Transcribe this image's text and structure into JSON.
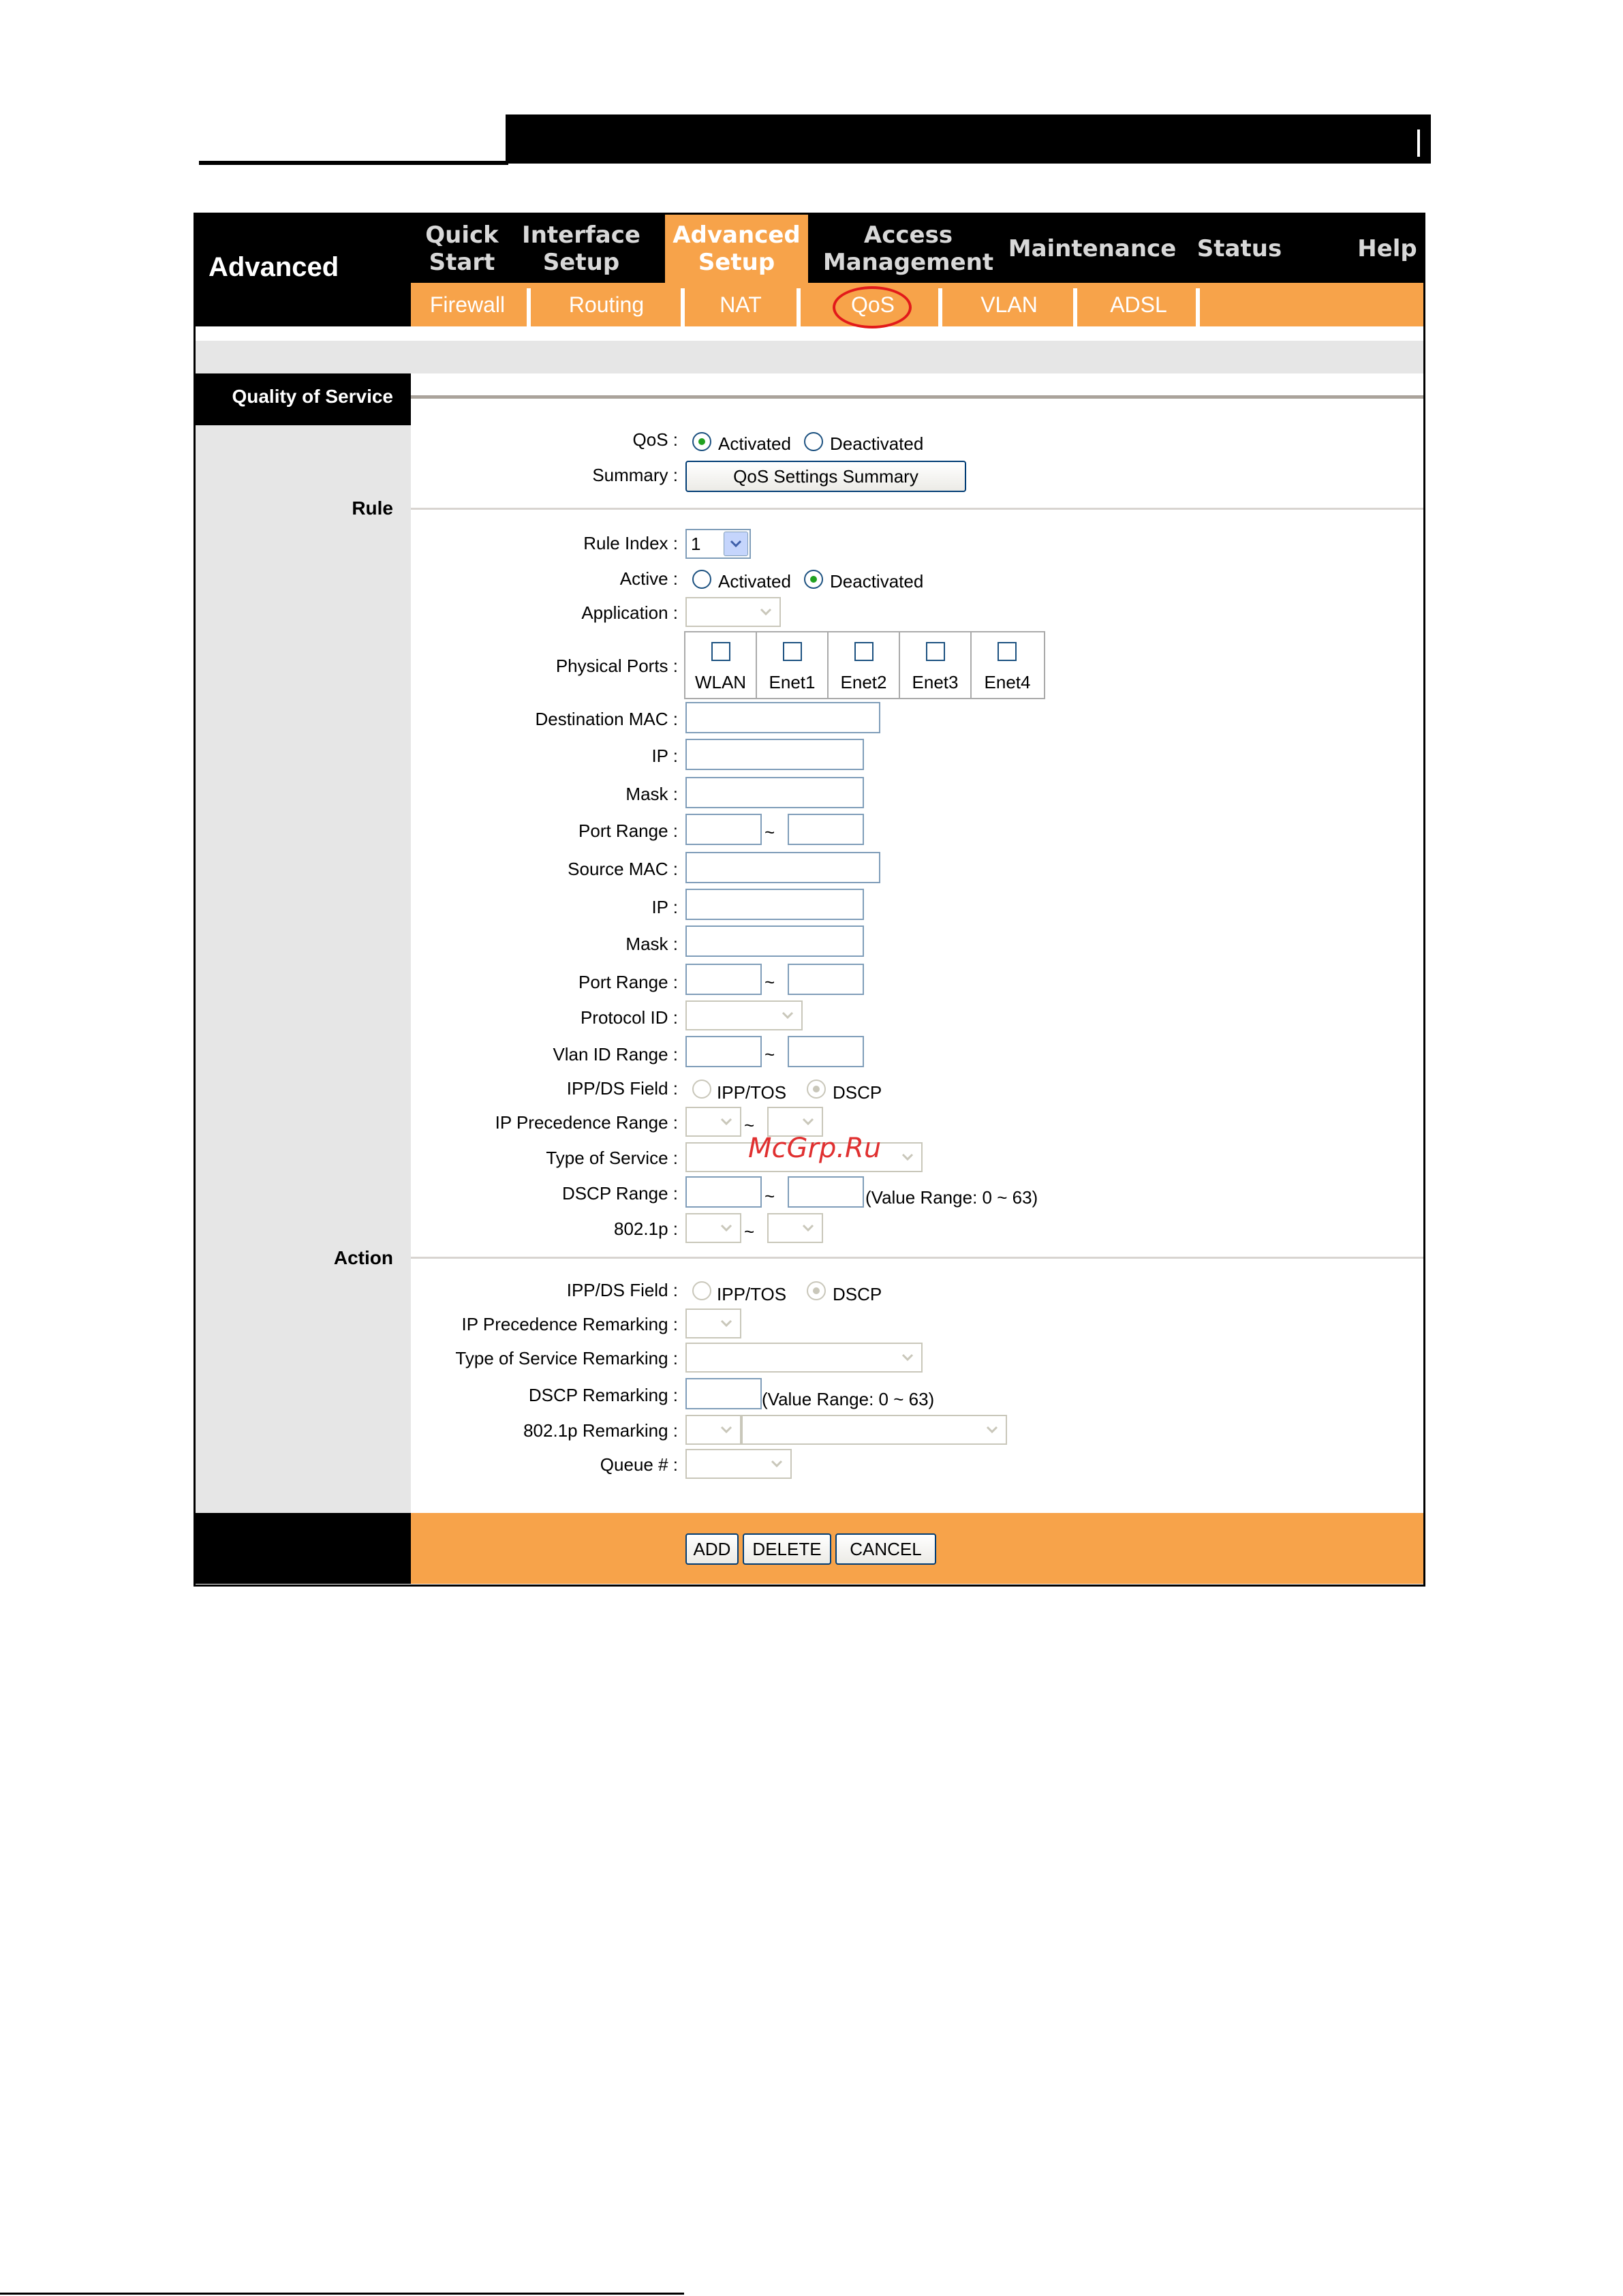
{
  "header": {
    "brand": "Advanced"
  },
  "nav": {
    "items": [
      {
        "label": "Quick\nStart"
      },
      {
        "label": "Interface\nSetup"
      },
      {
        "label": "Advanced\nSetup"
      },
      {
        "label": "Access\nManagement"
      },
      {
        "label": "Maintenance"
      },
      {
        "label": "Status"
      },
      {
        "label": "Help"
      }
    ]
  },
  "subnav": {
    "items": [
      "Firewall",
      "Routing",
      "NAT",
      "QoS",
      "VLAN",
      "ADSL"
    ]
  },
  "section": {
    "title": "Quality of Service"
  },
  "groups": {
    "rule": "Rule",
    "action": "Action"
  },
  "qos": {
    "label": "QoS :",
    "activated": "Activated",
    "deactivated": "Deactivated",
    "summary_label": "Summary :",
    "summary_button": "QoS Settings Summary"
  },
  "rule": {
    "index_label": "Rule Index :",
    "index_value": "1",
    "active_label": "Active :",
    "activated": "Activated",
    "deactivated": "Deactivated",
    "application_label": "Application :",
    "ports_label": "Physical Ports :",
    "ports": [
      "WLAN",
      "Enet1",
      "Enet2",
      "Enet3",
      "Enet4"
    ],
    "dest_mac_label": "Destination MAC :",
    "ip_label": "IP :",
    "mask_label": "Mask :",
    "port_range_label": "Port Range :",
    "src_mac_label": "Source MAC :",
    "ip2_label": "IP :",
    "mask2_label": "Mask :",
    "port_range2_label": "Port Range :",
    "protocol_label": "Protocol ID :",
    "vlan_label": "Vlan ID Range :",
    "ippds_label": "IPP/DS Field :",
    "ipptos": "IPP/TOS",
    "dscp": "DSCP",
    "ipprec_label": "IP Precedence Range :",
    "tos_label": "Type of Service :",
    "dscp_range_label": "DSCP Range :",
    "value_range": "(Value Range: 0 ~ 63)",
    "dot1p_label": "802.1p :",
    "tilde": "~"
  },
  "action": {
    "ippds_label": "IPP/DS Field :",
    "ipptos": "IPP/TOS",
    "dscp": "DSCP",
    "ipprec_label": "IP Precedence Remarking :",
    "tos_label": "Type of Service Remarking :",
    "dscp_label": "DSCP Remarking :",
    "value_range": "(Value Range: 0 ~ 63)",
    "dot1p_label": "802.1p Remarking :",
    "queue_label": "Queue # :"
  },
  "buttons": {
    "add": "ADD",
    "delete": "DELETE",
    "cancel": "CANCEL"
  },
  "watermark": "McGrp.Ru",
  "colors": {
    "accent": "#f7a34a",
    "header": "#000000",
    "panel": "#e6e6e6",
    "highlight_circle": "#e21a1a"
  }
}
